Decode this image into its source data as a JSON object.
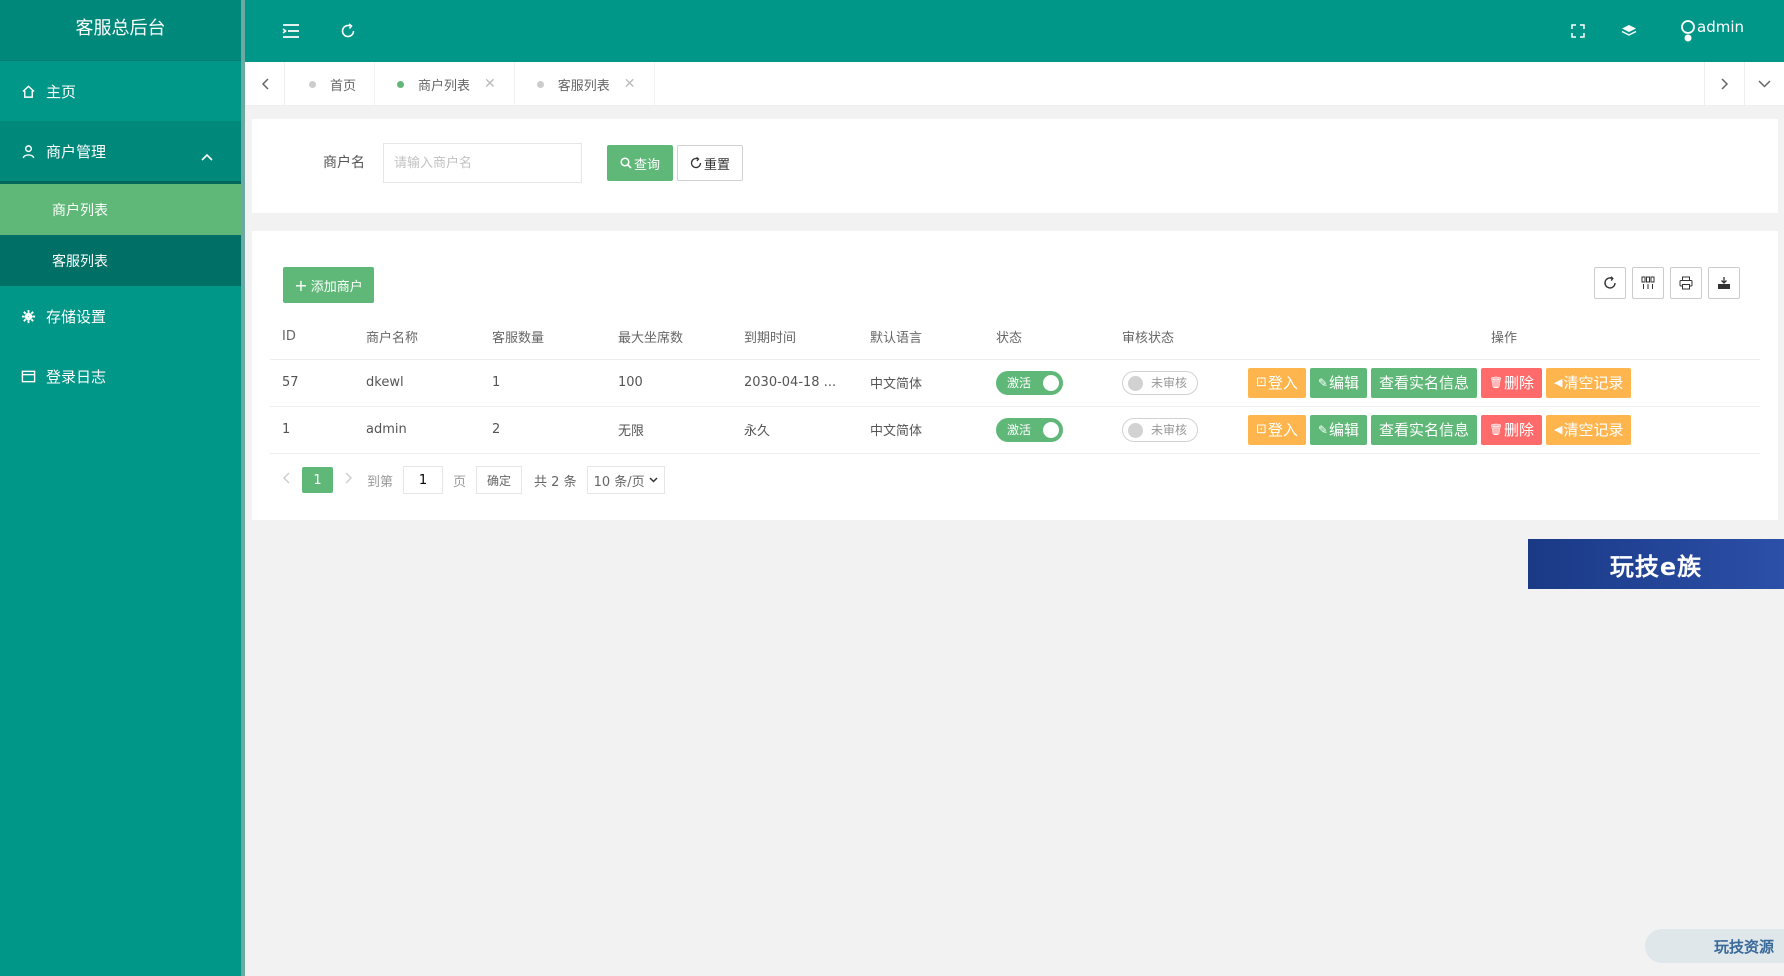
{
  "app": {
    "title": "客服总后台"
  },
  "sidebar": {
    "items": [
      {
        "label": "主页",
        "icon": "home-icon"
      },
      {
        "label": "商户管理",
        "icon": "user-icon",
        "children": [
          {
            "label": "商户列表",
            "active": true
          },
          {
            "label": "客服列表"
          }
        ]
      },
      {
        "label": "存储设置",
        "icon": "gear-icon"
      },
      {
        "label": "登录日志",
        "icon": "log-icon"
      }
    ]
  },
  "header": {
    "username": "admin",
    "icons": [
      "menu-toggle-icon",
      "refresh-icon",
      "fullscreen-icon",
      "theme-icon",
      "user-avatar-icon"
    ]
  },
  "tabs": [
    {
      "label": "首页",
      "active": false,
      "closable": false
    },
    {
      "label": "商户列表",
      "active": true,
      "closable": true
    },
    {
      "label": "客服列表",
      "active": false,
      "closable": true
    }
  ],
  "search": {
    "label": "商户名",
    "placeholder": "请输入商户名",
    "query_label": "查询",
    "reset_label": "重置"
  },
  "toolbar": {
    "add_label": "添加商户"
  },
  "table": {
    "columns": [
      "ID",
      "商户名称",
      "客服数量",
      "最大坐席数",
      "到期时间",
      "默认语言",
      "状态",
      "审核状态",
      "操作"
    ],
    "rows": [
      {
        "id": "57",
        "name": "dkewl",
        "agents": "1",
        "max_seats": "100",
        "expire": "2030-04-18 ...",
        "lang": "中文简体",
        "status": "激活",
        "review": "未审核"
      },
      {
        "id": "1",
        "name": "admin",
        "agents": "2",
        "max_seats": "无限",
        "expire": "永久",
        "lang": "中文简体",
        "status": "激活",
        "review": "未审核"
      }
    ],
    "ops": {
      "login": "登入",
      "edit": "编辑",
      "view": "查看实名信息",
      "delete": "删除",
      "clear": "清空记录"
    }
  },
  "pager": {
    "current": "1",
    "goto_label": "到第",
    "page_value": "1",
    "page_unit": "页",
    "ok_label": "确定",
    "total_label": "共 2 条",
    "size_label": "10 条/页"
  },
  "banner": {
    "text": "玩技e族"
  },
  "footer_badge": {
    "text": "玩技资源"
  },
  "colors": {
    "primary": "#009688",
    "green": "#5fb878",
    "orange": "#ffb54d",
    "red": "#ff6b6b"
  }
}
